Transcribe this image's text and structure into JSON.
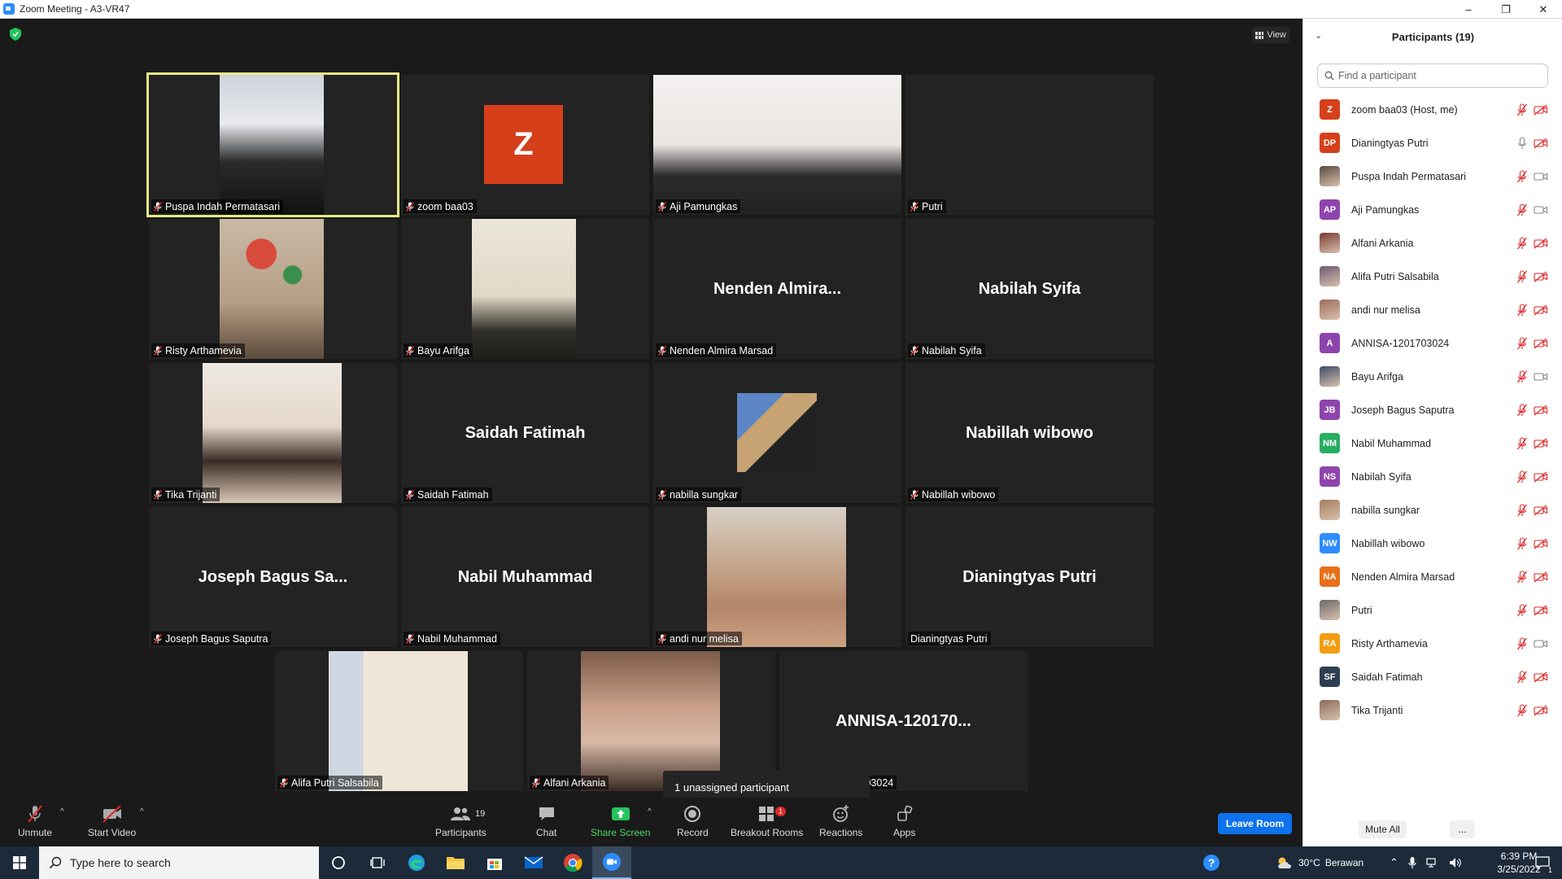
{
  "window": {
    "title": "Zoom Meeting - A3-VR47",
    "minimize": "–",
    "restore": "❐",
    "close": "✕"
  },
  "meeting": {
    "view_label": "View",
    "tiles": [
      {
        "name": "Puspa Indah Permatasari",
        "big": "",
        "kind": "video",
        "active": true
      },
      {
        "name": "zoom baa03",
        "big": "",
        "kind": "avatar",
        "avatar": "Z"
      },
      {
        "name": "Aji Pamungkas",
        "big": "",
        "kind": "video"
      },
      {
        "name": "Putri",
        "big": "",
        "kind": "blank"
      },
      {
        "name": "Risty Arthamevia",
        "big": "",
        "kind": "video"
      },
      {
        "name": "Bayu Arifga",
        "big": "",
        "kind": "video"
      },
      {
        "name": "Nenden Almira Marsad",
        "big": "Nenden  Almira...",
        "kind": "name"
      },
      {
        "name": "Nabilah Syifa",
        "big": "Nabilah Syifa",
        "kind": "name"
      },
      {
        "name": "Tika Trijanti",
        "big": "",
        "kind": "video"
      },
      {
        "name": "Saidah Fatimah",
        "big": "Saidah Fatimah",
        "kind": "name"
      },
      {
        "name": "nabilla sungkar",
        "big": "",
        "kind": "video"
      },
      {
        "name": "Nabillah wibowo",
        "big": "Nabillah wibowo",
        "kind": "name"
      },
      {
        "name": "Joseph Bagus Saputra",
        "big": "Joseph Bagus Sa...",
        "kind": "name"
      },
      {
        "name": "Nabil Muhammad",
        "big": "Nabil Muhammad",
        "kind": "name"
      },
      {
        "name": "andi nur melisa",
        "big": "",
        "kind": "video"
      },
      {
        "name": "Dianingtyas Putri",
        "big": "Dianingtyas Putri",
        "kind": "name",
        "unmuted": true
      },
      {
        "name": "Alifa Putri Salsabila",
        "big": "",
        "kind": "video"
      },
      {
        "name": "Alfani Arkania",
        "big": "",
        "kind": "video"
      },
      {
        "name": "ANNISA-1201703024",
        "big": "ANNISA-120170...",
        "kind": "name"
      }
    ],
    "annisa_label_tail": "03024",
    "popup": "1 unassigned participant"
  },
  "toolbar": {
    "unmute": "Unmute",
    "start_video": "Start Video",
    "participants": "Participants",
    "participants_count": "19",
    "chat": "Chat",
    "share_screen": "Share Screen",
    "record": "Record",
    "breakout_rooms": "Breakout Rooms",
    "breakout_badge": "1",
    "reactions": "Reactions",
    "apps": "Apps",
    "leave_room": "Leave Room"
  },
  "panel": {
    "title": "Participants (19)",
    "search_placeholder": "Find a participant",
    "participants": [
      {
        "name": "zoom baa03 (Host, me)",
        "initials": "Z",
        "color": "#d5401b",
        "mic": "off",
        "video": "off"
      },
      {
        "name": "Dianingtyas Putri",
        "initials": "DP",
        "color": "#d5401b",
        "mic": "on",
        "video": "off"
      },
      {
        "name": "Puspa Indah Permatasari",
        "initials": "",
        "color": "#5a4a40",
        "mic": "off",
        "video": "on"
      },
      {
        "name": "Aji Pamungkas",
        "initials": "AP",
        "color": "#8e44ad",
        "mic": "off",
        "video": "on"
      },
      {
        "name": "Alfani Arkania",
        "initials": "",
        "color": "#7a3b32",
        "mic": "off",
        "video": "off"
      },
      {
        "name": "Alifa Putri Salsabila",
        "initials": "",
        "color": "#6d5a70",
        "mic": "off",
        "video": "off"
      },
      {
        "name": "andi nur melisa",
        "initials": "",
        "color": "#9c6c5a",
        "mic": "off",
        "video": "off"
      },
      {
        "name": "ANNISA-1201703024",
        "initials": "A",
        "color": "#8e44ad",
        "mic": "off",
        "video": "off"
      },
      {
        "name": "Bayu Arifga",
        "initials": "",
        "color": "#3b4a66",
        "mic": "off",
        "video": "on"
      },
      {
        "name": "Joseph Bagus Saputra",
        "initials": "JB",
        "color": "#8e44ad",
        "mic": "off",
        "video": "off"
      },
      {
        "name": "Nabil Muhammad",
        "initials": "NM",
        "color": "#27ae60",
        "mic": "off",
        "video": "off"
      },
      {
        "name": "Nabilah Syifa",
        "initials": "NS",
        "color": "#8e44ad",
        "mic": "off",
        "video": "off"
      },
      {
        "name": "nabilla sungkar",
        "initials": "",
        "color": "#a57d5b",
        "mic": "off",
        "video": "off"
      },
      {
        "name": "Nabillah wibowo",
        "initials": "NW",
        "color": "#2d8cff",
        "mic": "off",
        "video": "off"
      },
      {
        "name": "Nenden Almira Marsad",
        "initials": "NA",
        "color": "#e8711a",
        "mic": "off",
        "video": "off"
      },
      {
        "name": "Putri",
        "initials": "",
        "color": "#6a6a6a",
        "mic": "off",
        "video": "off"
      },
      {
        "name": "Risty Arthamevia",
        "initials": "RA",
        "color": "#f39c12",
        "mic": "off",
        "video": "on"
      },
      {
        "name": "Saidah Fatimah",
        "initials": "SF",
        "color": "#2c3e50",
        "mic": "off",
        "video": "off"
      },
      {
        "name": "Tika Trijanti",
        "initials": "",
        "color": "#8a6d5a",
        "mic": "off",
        "video": "off"
      }
    ],
    "mute_all": "Mute All",
    "more": "..."
  },
  "taskbar": {
    "search_placeholder": "Type here to search",
    "weather_temp": "30°C",
    "weather_desc": "Berawan",
    "time": "6:39 PM",
    "date": "3/25/2022",
    "notification_count": "1"
  }
}
